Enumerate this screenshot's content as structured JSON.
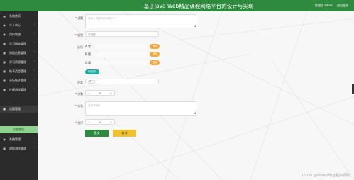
{
  "header": {
    "title": "基于Java Web精品课程网络平台的设计与实现",
    "admin_label": "管理员 admin",
    "logout_label": "退出登录"
  },
  "sidebar": {
    "items": [
      {
        "label": "系统首页"
      },
      {
        "label": "个人中心"
      },
      {
        "label": "用户管理"
      },
      {
        "label": "学习指南管理"
      },
      {
        "label": "课程信息管理"
      },
      {
        "label": "学习资源管理"
      },
      {
        "label": "帖子类型管理"
      },
      {
        "label": "论坛帖子管理"
      },
      {
        "label": "在线测试管理"
      },
      {
        "label": "试题管理"
      },
      {
        "label": "系统管理"
      },
      {
        "label": "课程测评管理"
      }
    ],
    "sub_item": "试题管理"
  },
  "form": {
    "question_label": "试题",
    "question_placeholder": "请输入试题内容与题号（？）",
    "type_label": "类型",
    "type_value": "单选题",
    "options_label": "选项",
    "options": [
      {
        "label": "A.考"
      },
      {
        "label": "B.题"
      },
      {
        "label": "C.简"
      }
    ],
    "delete_label": "删除",
    "add_option_label": "添加选项",
    "answer_label": "答案",
    "answer_value": "A",
    "score_label": "分数",
    "score_value": "30",
    "analysis_label": "分析",
    "analysis_placeholder": "请填写解析",
    "order_label": "排序",
    "order_value": "4",
    "submit_label": "提交",
    "cancel_label": "取消"
  },
  "watermark": "CSDN @nodejs毕业程序源码",
  "colors": {
    "header": "#2e8b3e",
    "sidebar": "#2b2b2b",
    "accent_orange": "#f2a93b",
    "accent_teal": "#1aa99a",
    "cancel_yellow": "#f3c12c"
  }
}
